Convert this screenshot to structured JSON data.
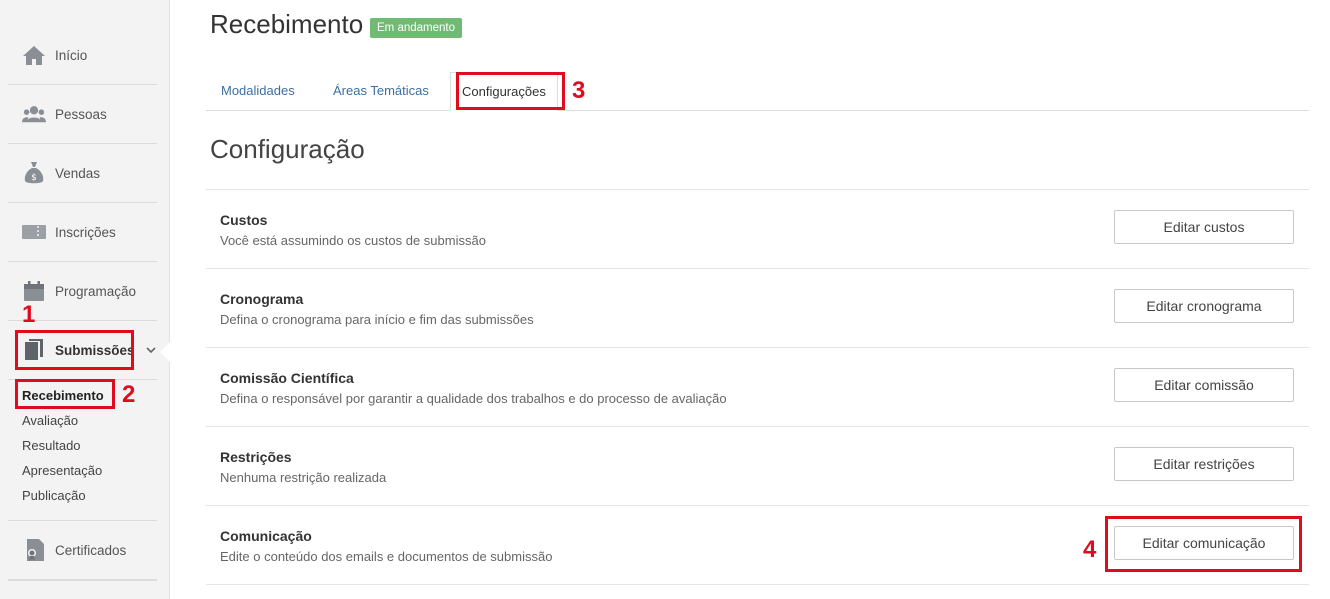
{
  "sidebar": {
    "items": [
      {
        "label": "Início",
        "icon": "home-icon"
      },
      {
        "label": "Pessoas",
        "icon": "people-icon"
      },
      {
        "label": "Vendas",
        "icon": "money-bag-icon"
      },
      {
        "label": "Inscrições",
        "icon": "ticket-icon"
      },
      {
        "label": "Programação",
        "icon": "calendar-icon"
      },
      {
        "label": "Submissões",
        "icon": "documents-icon"
      },
      {
        "label": "Certificados",
        "icon": "certificate-icon"
      }
    ],
    "subitems": [
      "Recebimento",
      "Avaliação",
      "Resultado",
      "Apresentação",
      "Publicação"
    ]
  },
  "header": {
    "title": "Recebimento",
    "status": "Em andamento"
  },
  "tabs": [
    "Modalidades",
    "Áreas Temáticas",
    "Configurações"
  ],
  "section": {
    "title": "Configuração"
  },
  "rows": [
    {
      "title": "Custos",
      "desc": "Você está assumindo os custos de submissão",
      "button": "Editar custos"
    },
    {
      "title": "Cronograma",
      "desc": "Defina o cronograma para início e fim das submissões",
      "button": "Editar cronograma"
    },
    {
      "title": "Comissão Científica",
      "desc": "Defina o responsável por garantir a qualidade dos trabalhos e do processo de avaliação",
      "button": "Editar comissão"
    },
    {
      "title": "Restrições",
      "desc": "Nenhuma restrição realizada",
      "button": "Editar restrições"
    },
    {
      "title": "Comunicação",
      "desc": "Edite o conteúdo dos emails e documentos de submissão",
      "button": "Editar comunicação"
    }
  ],
  "annotations": [
    "1",
    "2",
    "3",
    "4"
  ],
  "colors": {
    "accent_link": "#3d6fa0",
    "badge_green": "#6fbb73",
    "annotation_red": "#e00b1c"
  }
}
